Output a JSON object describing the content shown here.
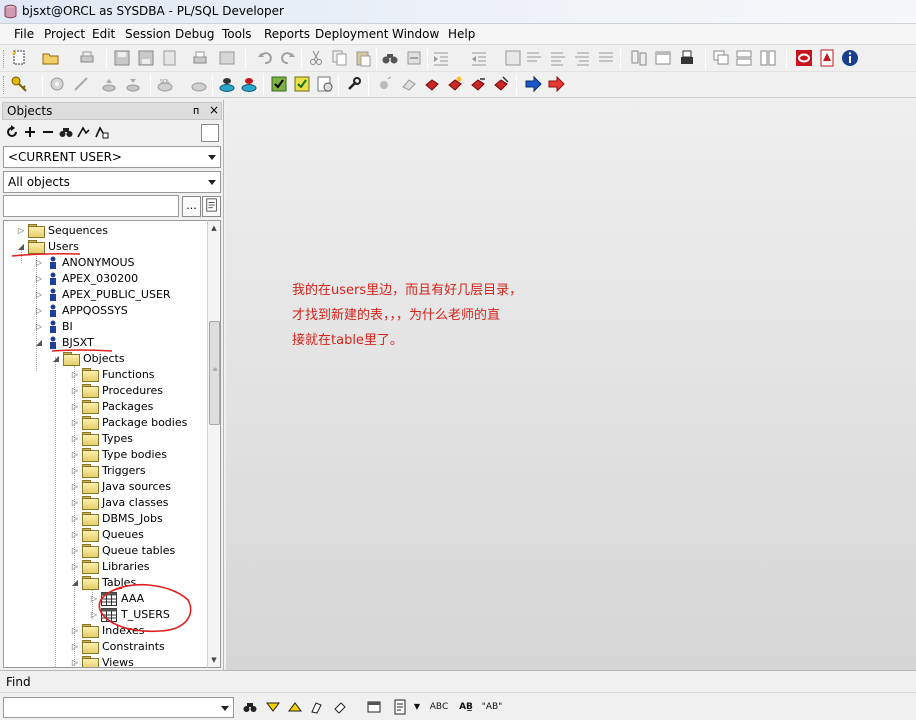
{
  "window": {
    "title": "bjsxt@ORCL as SYSDBA - PL/SQL Developer"
  },
  "menu": [
    "File",
    "Project",
    "Edit",
    "Session",
    "Debug",
    "Tools",
    "Reports",
    "Deployment",
    "Window",
    "Help"
  ],
  "objects_panel": {
    "title": "Objects",
    "pin_glyph": "ᴨ",
    "close_glyph": "×",
    "user_filter": "<CURRENT USER>",
    "object_filter": "All objects",
    "filter_button_label": "...",
    "search_value": ""
  },
  "tree": {
    "sequences": "Sequences",
    "users": "Users",
    "anonymous": "ANONYMOUS",
    "apex_030200": "APEX_030200",
    "apex_public_user": "APEX_PUBLIC_USER",
    "appqossys": "APPQOSSYS",
    "bi": "BI",
    "bjsxt": "BJSXT",
    "objects": "Objects",
    "functions": "Functions",
    "procedures": "Procedures",
    "packages": "Packages",
    "package_bodies": "Package bodies",
    "types": "Types",
    "type_bodies": "Type bodies",
    "triggers": "Triggers",
    "java_sources": "Java sources",
    "java_classes": "Java classes",
    "dbms_jobs": "DBMS_Jobs",
    "queues": "Queues",
    "queue_tables": "Queue tables",
    "libraries": "Libraries",
    "tables": "Tables",
    "aaa": "AAA",
    "t_users": "T_USERS",
    "indexes": "Indexes",
    "constraints": "Constraints",
    "views": "Views"
  },
  "annotation": {
    "line1": "我的在users里边，而且有好几层目录，",
    "line2": "才找到新建的表，，，为什么老师的直",
    "line3": "接就在table里了。"
  },
  "find": {
    "label": "Find",
    "value": "",
    "abc_label": "ABC",
    "word_label": "AB̲",
    "quote_label": "\"AB\""
  },
  "colors": {
    "annotation_red": "#d4241c",
    "brand_red": "#c4161c",
    "accent_blue": "#1a56c8"
  }
}
